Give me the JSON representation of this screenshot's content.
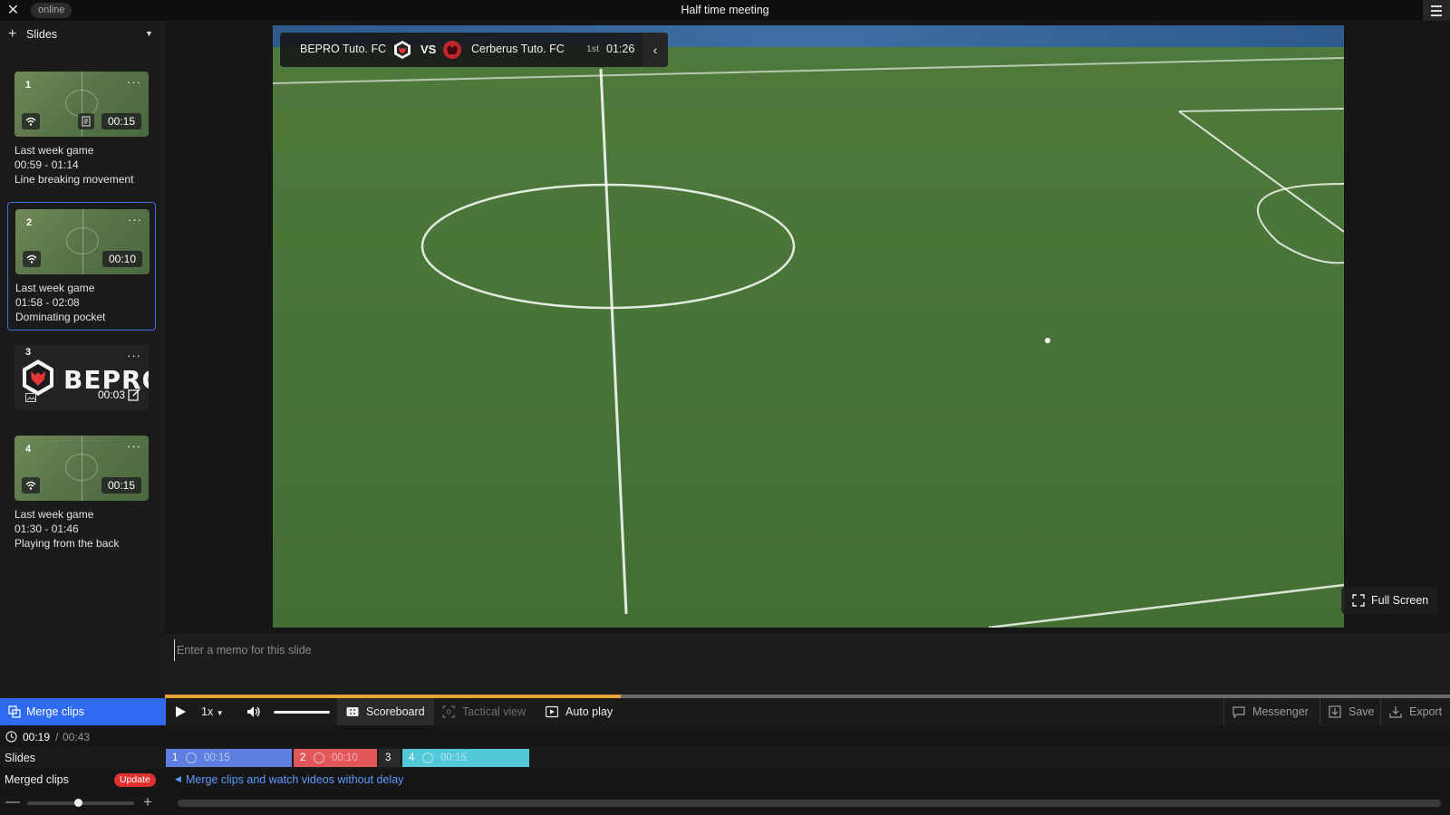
{
  "window": {
    "title": "Half time meeting",
    "status": "online"
  },
  "sidebar": {
    "header_label": "Slides",
    "slides": [
      {
        "number": "1",
        "duration": "00:15",
        "source": "Last week game",
        "range": "00:59 - 01:14",
        "name": "Line breaking movement",
        "type": "clip"
      },
      {
        "number": "2",
        "duration": "00:10",
        "source": "Last week game",
        "range": "01:58 - 02:08",
        "name": "Dominating pocket",
        "type": "clip",
        "active": true
      },
      {
        "number": "3",
        "duration": "00:03",
        "type": "image",
        "logo_text": "BEPRO"
      },
      {
        "number": "4",
        "duration": "00:15",
        "source": "Last week game",
        "range": "01:30 - 01:46",
        "name": "Playing from the back",
        "type": "clip"
      }
    ]
  },
  "scoreboard": {
    "home_team": "BEPRO Tuto. FC",
    "vs": "VS",
    "away_team": "Cerberus Tuto. FC",
    "half": "1st",
    "clock": "01:26"
  },
  "video": {
    "fullscreen_label": "Full Screen"
  },
  "memo": {
    "placeholder": "Enter a memo for this slide"
  },
  "playback": {
    "progress": 0.355
  },
  "controls": {
    "merge_label": "Merge clips",
    "speed": "1x",
    "scoreboard_label": "Scoreboard",
    "tactical_label": "Tactical view",
    "autoplay_label": "Auto play",
    "messenger_label": "Messenger",
    "save_label": "Save",
    "export_label": "Export"
  },
  "time": {
    "current": "00:19",
    "separator": "/",
    "total": "00:43"
  },
  "timeline": {
    "slides_label": "Slides",
    "segments": [
      {
        "number": "1",
        "duration": "00:15",
        "color": "#5e7fe0"
      },
      {
        "number": "2",
        "duration": "00:10",
        "color": "#e2575a"
      },
      {
        "number": "3",
        "duration": "",
        "color": "#2a2a2a"
      },
      {
        "number": "4",
        "duration": "00:15",
        "color": "#52c8d8"
      }
    ],
    "merged_label": "Merged clips",
    "update_badge": "Update",
    "merge_hint": "Merge clips and watch videos without delay"
  },
  "colors": {
    "accent": "#2f6bf0",
    "progress": "#e8a23a",
    "badge": "#e03030"
  }
}
